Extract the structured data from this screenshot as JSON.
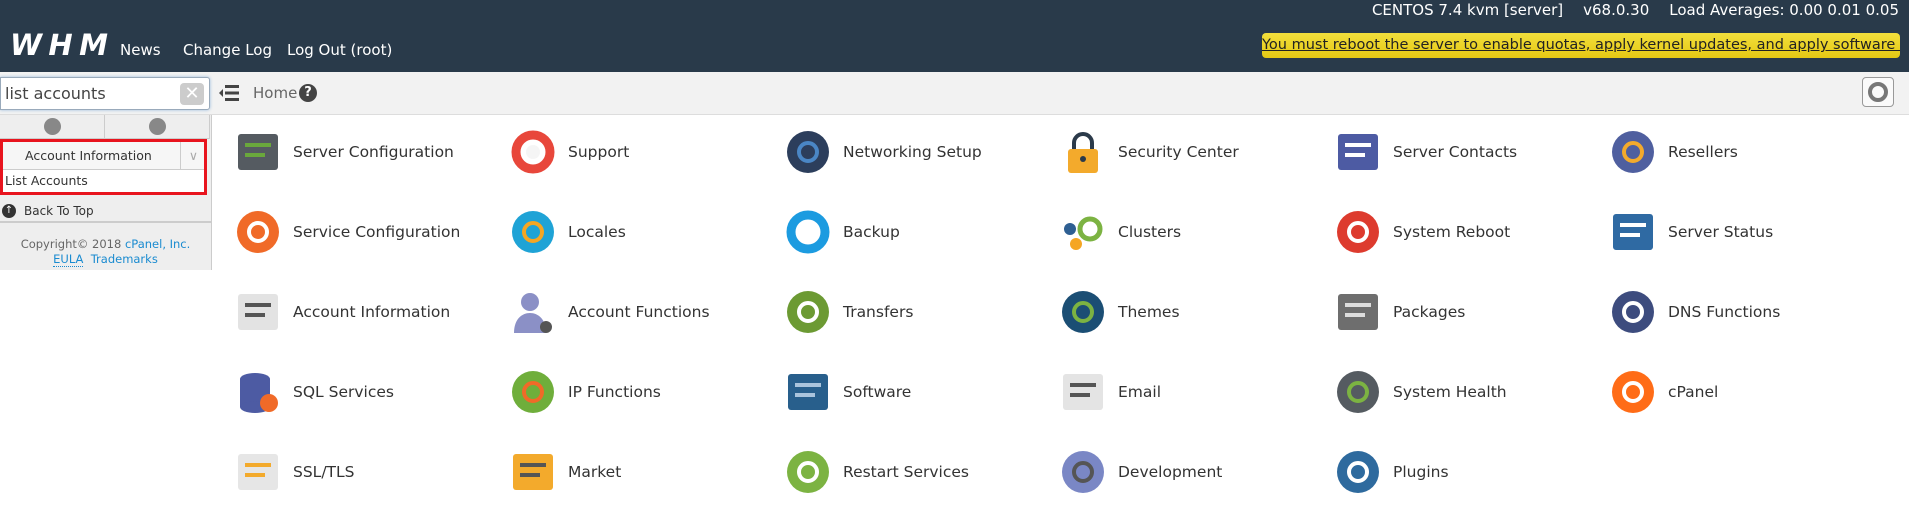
{
  "header": {
    "logo": "WHM",
    "os": "CENTOS 7.4 kvm [server]",
    "version": "v68.0.30",
    "load": "Load Averages: 0.00 0.01 0.05",
    "nav": [
      "News",
      "Change Log",
      "Log Out (root)"
    ],
    "banner": "You must reboot the server to enable quotas, apply kernel updates, and apply software updates."
  },
  "toolbar": {
    "search_value": "list accounts",
    "breadcrumb": "Home"
  },
  "sidebar": {
    "category": "Account Information",
    "result": "List Accounts",
    "back_to_top": "Back To Top",
    "copyright": "Copyright© 2018",
    "company": "cPanel, Inc.",
    "eula": "EULA",
    "trademarks": "Trademarks"
  },
  "colors": {
    "header_bg": "#293a4a",
    "banner": "#f0d82a",
    "highlight": "#e8141e",
    "link": "#1a8bd0"
  },
  "items": [
    {
      "label": "Server Configuration",
      "icon": "server-gear-icon",
      "shape": "rect",
      "color": "#555b61",
      "accent": "#6aa83c"
    },
    {
      "label": "Support",
      "icon": "lifebuoy-icon",
      "shape": "ring",
      "color": "#e8473b",
      "accent": "#eeeeee"
    },
    {
      "label": "Networking Setup",
      "icon": "network-icon",
      "shape": "circle",
      "color": "#2c3e5c",
      "accent": "#4a86c5"
    },
    {
      "label": "Security Center",
      "icon": "padlock-icon",
      "shape": "lock",
      "color": "#f3aa2c",
      "accent": "#2b3a4a"
    },
    {
      "label": "Server Contacts",
      "icon": "contacts-icon",
      "shape": "rect",
      "color": "#4d5ba3",
      "accent": "#ffffff"
    },
    {
      "label": "Resellers",
      "icon": "tag-icon",
      "shape": "circle",
      "color": "#4f5f9f",
      "accent": "#f3aa2c"
    },
    {
      "label": "Service Configuration",
      "icon": "wrench-gear-icon",
      "shape": "circle",
      "color": "#f06a28",
      "accent": "#ffffff"
    },
    {
      "label": "Locales",
      "icon": "speech-bubble-icon",
      "shape": "circle",
      "color": "#1fa3d6",
      "accent": "#f5a623"
    },
    {
      "label": "Backup",
      "icon": "backup-clock-icon",
      "shape": "ring",
      "color": "#1c9be0",
      "accent": "#ffffff"
    },
    {
      "label": "Clusters",
      "icon": "clusters-icon",
      "shape": "dots",
      "color": "#7cb342",
      "accent": "#f5a623"
    },
    {
      "label": "System Reboot",
      "icon": "power-icon",
      "shape": "circle",
      "color": "#dd3b2e",
      "accent": "#ffffff"
    },
    {
      "label": "Server Status",
      "icon": "monitor-pulse-icon",
      "shape": "rect",
      "color": "#2f6aa3",
      "accent": "#ffffff"
    },
    {
      "label": "Account Information",
      "icon": "id-card-icon",
      "shape": "rect",
      "color": "#e3e3e3",
      "accent": "#555555"
    },
    {
      "label": "Account Functions",
      "icon": "user-gear-icon",
      "shape": "user",
      "color": "#8b90c6",
      "accent": "#555555"
    },
    {
      "label": "Transfers",
      "icon": "transfer-arrows-icon",
      "shape": "circle",
      "color": "#6c9a33",
      "accent": "#ffffff"
    },
    {
      "label": "Themes",
      "icon": "paint-bucket-icon",
      "shape": "circle",
      "color": "#1b4e74",
      "accent": "#7cb342"
    },
    {
      "label": "Packages",
      "icon": "package-box-icon",
      "shape": "rect",
      "color": "#6e6e6e",
      "accent": "#dddddd"
    },
    {
      "label": "DNS Functions",
      "icon": "dns-icon",
      "shape": "circle",
      "color": "#3d4c7e",
      "accent": "#ffffff"
    },
    {
      "label": "SQL Services",
      "icon": "database-icon",
      "shape": "db",
      "color": "#4d5ba3",
      "accent": "#f06a28"
    },
    {
      "label": "IP Functions",
      "icon": "globe-ip-icon",
      "shape": "circle",
      "color": "#6fae3b",
      "accent": "#f06a28"
    },
    {
      "label": "Software",
      "icon": "software-window-icon",
      "shape": "rect",
      "color": "#285f8c",
      "accent": "#aac4dc"
    },
    {
      "label": "Email",
      "icon": "envelope-icon",
      "shape": "rect",
      "color": "#e4e4e4",
      "accent": "#555555"
    },
    {
      "label": "System Health",
      "icon": "gear-pulse-icon",
      "shape": "circle",
      "color": "#555b61",
      "accent": "#7cb342"
    },
    {
      "label": "cPanel",
      "icon": "cpanel-logo-icon",
      "shape": "circle",
      "color": "#ff6c17",
      "accent": "#ffffff"
    },
    {
      "label": "SSL/TLS",
      "icon": "certificate-icon",
      "shape": "rect",
      "color": "#e6e6e6",
      "accent": "#f3aa2c"
    },
    {
      "label": "Market",
      "icon": "shopping-cart-icon",
      "shape": "rect",
      "color": "#f3aa2c",
      "accent": "#555555"
    },
    {
      "label": "Restart Services",
      "icon": "restart-icon",
      "shape": "circle",
      "color": "#7cb342",
      "accent": "#ffffff"
    },
    {
      "label": "Development",
      "icon": "hammer-gear-icon",
      "shape": "circle",
      "color": "#7a87c5",
      "accent": "#555555"
    },
    {
      "label": "Plugins",
      "icon": "plug-icon",
      "shape": "circle",
      "color": "#2e6a9e",
      "accent": "#ffffff"
    }
  ]
}
